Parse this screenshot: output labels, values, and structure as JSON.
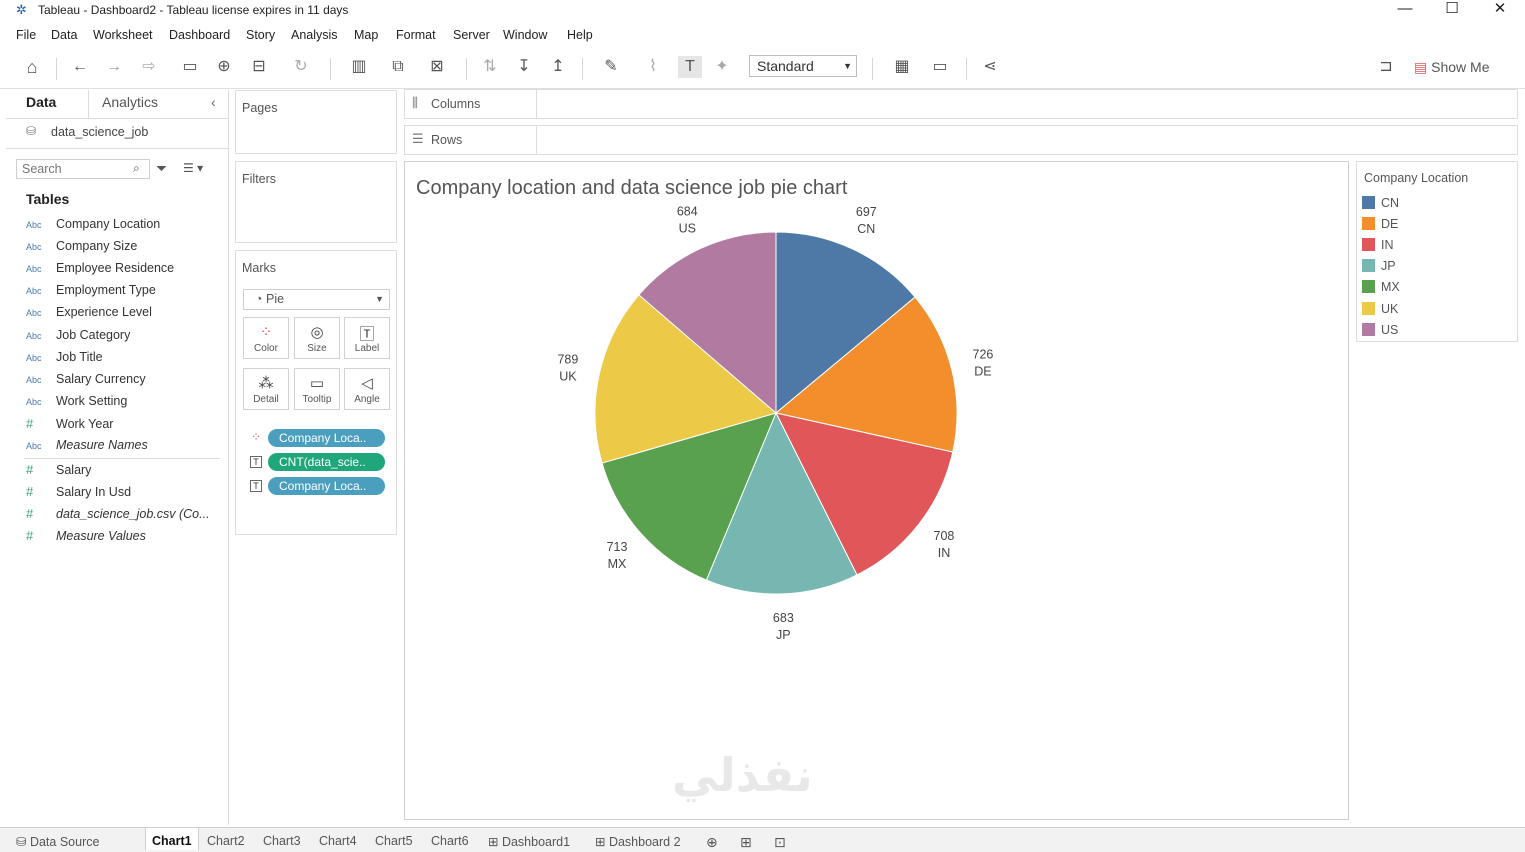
{
  "window": {
    "title": "Tableau - Dashboard2 - Tableau license expires in 11 days",
    "controls": {
      "minimize": "—",
      "maximize": "☐",
      "close": "✕"
    }
  },
  "menu": [
    "File",
    "Data",
    "Worksheet",
    "Dashboard",
    "Story",
    "Analysis",
    "Map",
    "Format",
    "Server",
    "Window",
    "Help"
  ],
  "toolbar": {
    "fit_select": "Standard",
    "show_me": "Show Me"
  },
  "data_pane": {
    "tabs": {
      "data": "Data",
      "analytics": "Analytics"
    },
    "datasource": "data_science_job",
    "search_placeholder": "Search",
    "tables_heading": "Tables",
    "dimensions": [
      {
        "type": "Abc",
        "label": "Company Location"
      },
      {
        "type": "Abc",
        "label": "Company Size"
      },
      {
        "type": "Abc",
        "label": "Employee Residence"
      },
      {
        "type": "Abc",
        "label": "Employment Type"
      },
      {
        "type": "Abc",
        "label": "Experience Level"
      },
      {
        "type": "Abc",
        "label": "Job Category"
      },
      {
        "type": "Abc",
        "label": "Job Title"
      },
      {
        "type": "Abc",
        "label": "Salary Currency"
      },
      {
        "type": "Abc",
        "label": "Work Setting"
      },
      {
        "type": "#",
        "label": "Work Year"
      },
      {
        "type": "Abc",
        "label": "Measure Names"
      }
    ],
    "measures": [
      {
        "type": "#",
        "label": "Salary"
      },
      {
        "type": "#",
        "label": "Salary In Usd"
      },
      {
        "type": "#",
        "label": "data_science_job.csv (Co..."
      },
      {
        "type": "#",
        "label": "Measure Values"
      }
    ]
  },
  "cards": {
    "pages": "Pages",
    "filters": "Filters",
    "marks": "Marks",
    "mark_type": "Pie",
    "mark_buttons": [
      "Color",
      "Size",
      "Label",
      "Detail",
      "Tooltip",
      "Angle"
    ],
    "pills": [
      {
        "label": "Company Loca..",
        "color": "#4a9fbf"
      },
      {
        "label": "CNT(data_scie..",
        "color": "#1fa67a"
      },
      {
        "label": "Company Loca..",
        "color": "#4a9fbf"
      }
    ]
  },
  "shelves": {
    "columns": "Columns",
    "rows": "Rows"
  },
  "chart_data": {
    "type": "pie",
    "title": "Company location and data science job pie chart",
    "categories": [
      "CN",
      "DE",
      "IN",
      "JP",
      "MX",
      "UK",
      "US"
    ],
    "values": [
      697,
      726,
      708,
      683,
      713,
      789,
      684
    ],
    "colors": [
      "#4e79a7",
      "#f28e2b",
      "#e15759",
      "#76b7b2",
      "#59a14f",
      "#edc948",
      "#b07aa1"
    ],
    "start": "12 o'clock, clockwise"
  },
  "legend": {
    "title": "Company Location",
    "items": [
      {
        "label": "CN",
        "color": "#4e79a7"
      },
      {
        "label": "DE",
        "color": "#f28e2b"
      },
      {
        "label": "IN",
        "color": "#e15759"
      },
      {
        "label": "JP",
        "color": "#76b7b2"
      },
      {
        "label": "MX",
        "color": "#59a14f"
      },
      {
        "label": "UK",
        "color": "#edc948"
      },
      {
        "label": "US",
        "color": "#b07aa1"
      }
    ]
  },
  "sheet_tabs": {
    "data_source": "Data Source",
    "sheets": [
      "Chart1",
      "Chart2",
      "Chart3",
      "Chart4",
      "Chart5",
      "Chart6"
    ],
    "dashboards": [
      "Dashboard1",
      "Dashboard 2"
    ],
    "active": "Chart1"
  },
  "watermark": "نفذلي"
}
